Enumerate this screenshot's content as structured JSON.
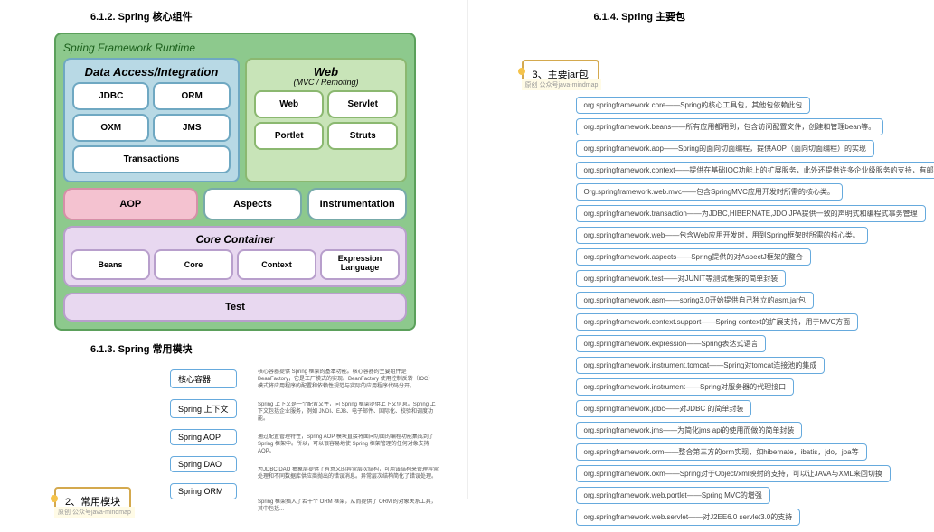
{
  "left": {
    "h1": "6.1.2. Spring 核心组件",
    "sfr": {
      "title": "Spring Framework Runtime",
      "dai": {
        "title": "Data Access/Integration",
        "cells": [
          "JDBC",
          "ORM",
          "OXM",
          "JMS",
          "Transactions"
        ]
      },
      "web": {
        "title": "Web",
        "subtitle": "(MVC / Remoting)",
        "cells": [
          "Web",
          "Servlet",
          "Portlet",
          "Struts"
        ]
      },
      "midrow": [
        "AOP",
        "Aspects",
        "Instrumentation"
      ],
      "core": {
        "title": "Core Container",
        "cells": [
          "Beans",
          "Core",
          "Context",
          "Expression Language"
        ]
      },
      "test": "Test"
    },
    "h2": "6.1.3. Spring 常用模块",
    "mm": {
      "root": "2、常用模块",
      "caption": "原创 公众号java-mindmap",
      "nodes": [
        {
          "name": "核心容器",
          "desc": "核心容器提供 Spring 框架的基本功能。核心容器的主要组件是 BeanFactory，它是工厂模式的实现。BeanFactory 使用控制反转（IOC）模式将应用程序的配置和依赖性规范与实际的应用程序代码分开。"
        },
        {
          "name": "Spring 上下文",
          "desc": "Spring 上下文是一个配置文件，向 Spring 框架提供上下文信息。Spring 上下文包括企业服务，例如 JNDI、EJB、电子邮件、国际化、校验和调度功能。"
        },
        {
          "name": "Spring AOP",
          "desc": "通过配置管理特性，Spring AOP 模块直接将面向切面的编程功能集成到了 Spring 框架中。所以，可以很容易地使 Spring 框架管理的任何对象支持 AOP。"
        },
        {
          "name": "Spring DAO",
          "desc": "为JDBC DAO 抽象层提供了有意义的异常层次结构，可用该结构来管理异常处理和不同数据库供应商抛出的错误消息。异常层次结构简化了错误处理。"
        },
        {
          "name": "Spring ORM",
          "desc": "Spring 框架插入了若干个 ORM 框架，从而提供了 ORM 的对象关系工具，其中包括..."
        }
      ]
    }
  },
  "right": {
    "h1": "6.1.4. Spring 主要包",
    "mm": {
      "root": "3、主要jar包",
      "caption": "原创 公众号java-mindmap",
      "jars": [
        "org.springframework.core——Spring的核心工具包，其他包依赖此包",
        "org.springframework.beans——所有应用都用到，包含访问配置文件，创建和管理bean等。",
        "org.springframework.aop——Spring的面向切面编程，提供AOP（面向切面编程）的实现",
        "org.springframework.context——提供在基础IOC功能上的扩展服务，此外还提供许多企业级服务的支持，有邮件服务、任务调度、JNDI定位、EJB集成、远程访问、缓存以及多种视图层框架的支持。",
        "Org.springframework.web.mvc——包含SpringMVC应用开发时所需的核心类。",
        "org.springframework.transaction——为JDBC,HIBERNATE,JDO,JPA提供一致的声明式和编程式事务管理",
        "org.springframework.web——包含Web应用开发时，用到Spring框架时所需的核心类。",
        "org.springframework.aspects——Spring提供的对AspectJ框架的整合",
        "org.springframework.test——对JUNIT等测试框架的简单封装",
        "org.springframework.asm——spring3.0开始提供自己独立的asm.jar包",
        "org.springframework.context.support——Spring context的扩展支持，用于MVC方面",
        "org.springframework.expression——Spring表达式语言",
        "org.springframework.instrument.tomcat——Spring对tomcat连接池的集成",
        "org.springframework.instrument——Spring对服务器的代理接口",
        "org.springframework.jdbc——对JDBC 的简单封装",
        "org.springframework.jms——为简化jms api的使用而做的简单封装",
        "org.springframework.orm——整合第三方的orm实现，如hibernate，ibatis，jdo，jpa等",
        "org.springframework.oxm——Spring对于Object/xml映射的支持，可以让JAVA与XML来回切换",
        "org.springframework.web.portlet——Spring MVC的增强",
        "org.springframework.web.servlet——对J2EE6.0 servlet3.0的支持"
      ]
    }
  }
}
